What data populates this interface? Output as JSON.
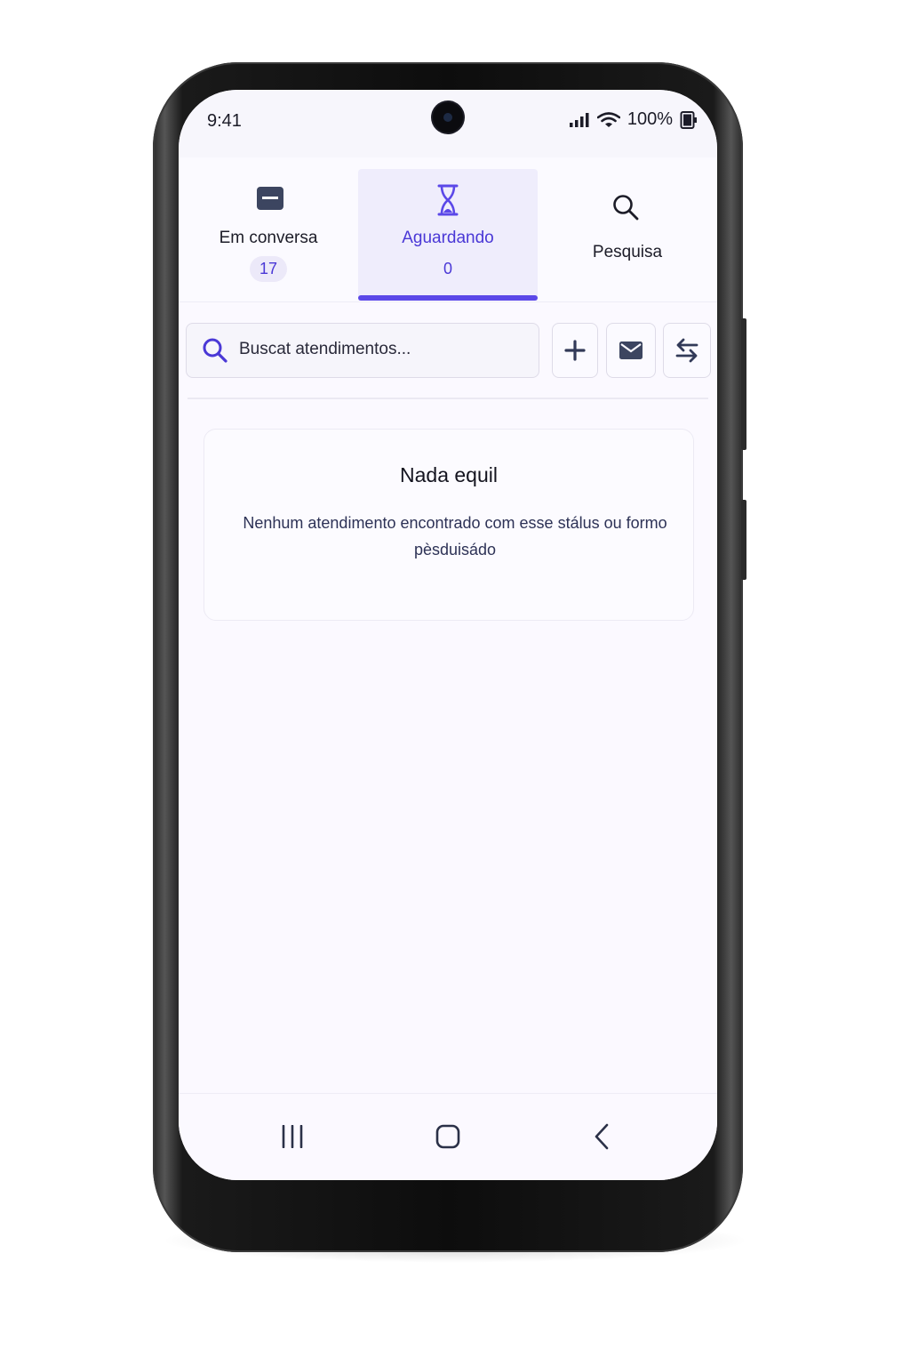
{
  "status_bar": {
    "time": "9:41",
    "battery": "100%",
    "icons": [
      "signal-icon",
      "wifi-icon",
      "battery-icon"
    ]
  },
  "tabs": [
    {
      "label": "Em conversa",
      "count": "17",
      "icon": "chat-icon",
      "active": false
    },
    {
      "label": "Aguardando",
      "count": "0",
      "icon": "hourglass-icon",
      "active": true
    },
    {
      "label": "Pesquisa",
      "icon": "search-icon",
      "active": false
    }
  ],
  "search": {
    "placeholder": "Buscat atendimentos..."
  },
  "toolbar_buttons": [
    "add-icon",
    "mail-icon",
    "swap-icon"
  ],
  "empty_state": {
    "title": "Nada equil",
    "message": "Nenhum atendimento encontrado com esse stálus ou formo pèsduisádo"
  },
  "nav_bar": [
    "recents-icon",
    "home-icon",
    "back-icon"
  ],
  "colors": {
    "accent": "#5b48e8",
    "accent_text": "#4a38d6",
    "screen_bg": "#fbf9ff"
  }
}
